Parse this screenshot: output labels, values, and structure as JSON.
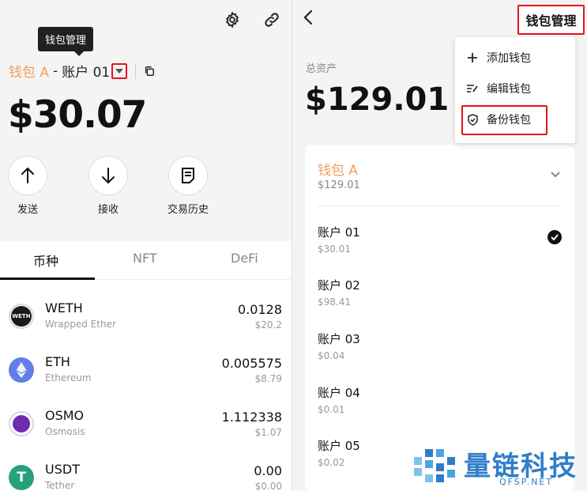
{
  "left": {
    "tooltip": "钱包管理",
    "wallet_name": "钱包 A",
    "separator": "-",
    "account_name": "账户 01",
    "balance": "$30.07",
    "actions": [
      {
        "label": "发送",
        "icon": "arrow-up-icon"
      },
      {
        "label": "接收",
        "icon": "arrow-down-icon"
      },
      {
        "label": "交易历史",
        "icon": "history-icon"
      }
    ],
    "tabs": [
      "币种",
      "NFT",
      "DeFi"
    ],
    "active_tab": 0,
    "coins": [
      {
        "symbol": "WETH",
        "name": "Wrapped Ether",
        "amount": "0.0128",
        "usd": "$20.2",
        "logo_text": "WETH",
        "color": "#ffffff"
      },
      {
        "symbol": "ETH",
        "name": "Ethereum",
        "amount": "0.005575",
        "usd": "$8.79",
        "logo_text": "",
        "color": "#627eea"
      },
      {
        "symbol": "OSMO",
        "name": "Osmosis",
        "amount": "1.112338",
        "usd": "$1.07",
        "logo_text": "",
        "color": "#6d2bb0"
      },
      {
        "symbol": "USDT",
        "name": "Tether",
        "amount": "0.00",
        "usd": "$0.00",
        "logo_text": "T",
        "color": "#26a17b"
      }
    ]
  },
  "right": {
    "header_title": "钱包管理",
    "total_label": "总资产",
    "total_amount": "$129.01",
    "menu": [
      {
        "label": "添加钱包",
        "icon": "plus-icon"
      },
      {
        "label": "编辑钱包",
        "icon": "edit-icon"
      },
      {
        "label": "备份钱包",
        "icon": "shield-icon"
      }
    ],
    "wallet": {
      "name": "钱包 A",
      "amount": "$129.01"
    },
    "accounts": [
      {
        "name": "账户 01",
        "value": "$30.01",
        "selected": true
      },
      {
        "name": "账户 02",
        "value": "$98.41",
        "selected": false
      },
      {
        "name": "账户 03",
        "value": "$0.04",
        "selected": false
      },
      {
        "name": "账户 04",
        "value": "$0.01",
        "selected": false
      },
      {
        "name": "账户 05",
        "value": "$0.02",
        "selected": false
      }
    ]
  },
  "watermark": {
    "title": "量链科技",
    "subtitle": "QFSP.NET"
  },
  "colors": {
    "accent_orange": "#f0a060",
    "highlight_red": "#e3141b",
    "watermark_blue": "#2f7ec9"
  }
}
